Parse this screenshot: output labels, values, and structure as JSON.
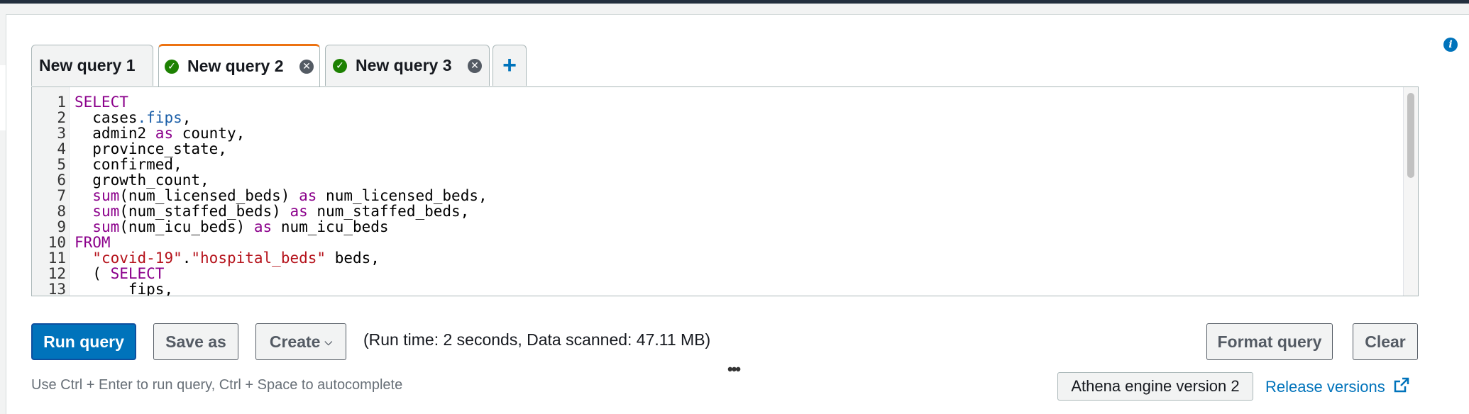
{
  "tabs": [
    {
      "label": "New query 1",
      "status": "none",
      "closable": false,
      "active": false
    },
    {
      "label": "New query 2",
      "status": "success",
      "closable": true,
      "active": true
    },
    {
      "label": "New query 3",
      "status": "success",
      "closable": true,
      "active": false
    }
  ],
  "add_tab_label": "+",
  "editor": {
    "line_numbers": [
      "1",
      "2",
      "3",
      "4",
      "5",
      "6",
      "7",
      "8",
      "9",
      "10",
      "11",
      "12",
      "13"
    ],
    "lines": [
      [
        {
          "t": "SELECT",
          "c": "kw"
        }
      ],
      [
        {
          "t": "  cases",
          "c": ""
        },
        {
          "t": ".fips",
          "c": "prop"
        },
        {
          "t": ",",
          "c": ""
        }
      ],
      [
        {
          "t": "  admin2 ",
          "c": ""
        },
        {
          "t": "as",
          "c": "kw"
        },
        {
          "t": " county,",
          "c": ""
        }
      ],
      [
        {
          "t": "  province_state,",
          "c": ""
        }
      ],
      [
        {
          "t": "  confirmed,",
          "c": ""
        }
      ],
      [
        {
          "t": "  growth_count,",
          "c": ""
        }
      ],
      [
        {
          "t": "  ",
          "c": ""
        },
        {
          "t": "sum",
          "c": "kw"
        },
        {
          "t": "(num_licensed_beds) ",
          "c": ""
        },
        {
          "t": "as",
          "c": "kw"
        },
        {
          "t": " num_licensed_beds,",
          "c": ""
        }
      ],
      [
        {
          "t": "  ",
          "c": ""
        },
        {
          "t": "sum",
          "c": "kw"
        },
        {
          "t": "(num_staffed_beds) ",
          "c": ""
        },
        {
          "t": "as",
          "c": "kw"
        },
        {
          "t": " num_staffed_beds,",
          "c": ""
        }
      ],
      [
        {
          "t": "  ",
          "c": ""
        },
        {
          "t": "sum",
          "c": "kw"
        },
        {
          "t": "(num_icu_beds) ",
          "c": ""
        },
        {
          "t": "as",
          "c": "kw"
        },
        {
          "t": " num_icu_beds",
          "c": ""
        }
      ],
      [
        {
          "t": "FROM",
          "c": "kw"
        }
      ],
      [
        {
          "t": "  ",
          "c": ""
        },
        {
          "t": "\"covid-19\"",
          "c": "str"
        },
        {
          "t": ".",
          "c": ""
        },
        {
          "t": "\"hospital_beds\"",
          "c": "str"
        },
        {
          "t": " beds,",
          "c": ""
        }
      ],
      [
        {
          "t": "  ( ",
          "c": ""
        },
        {
          "t": "SELECT",
          "c": "kw"
        }
      ],
      [
        {
          "t": "      fips,",
          "c": ""
        }
      ]
    ]
  },
  "toolbar": {
    "run_label": "Run query",
    "save_as_label": "Save as",
    "create_label": "Create",
    "run_info": "(Run time: 2 seconds, Data scanned: 47.11 MB)",
    "format_label": "Format query",
    "clear_label": "Clear",
    "resize_handle": "•••"
  },
  "footer": {
    "hint": "Use Ctrl + Enter to run query, Ctrl + Space to autocomplete",
    "engine_version": "Athena engine version 2",
    "release_link": "Release versions"
  },
  "icons": {
    "info": "info-icon",
    "success": "check-circle-icon",
    "close": "close-circle-icon",
    "external": "external-link-icon"
  },
  "colors": {
    "primary": "#0073bb",
    "active_tab_accent": "#ec7211",
    "success": "#1d8102",
    "keyword": "#8b008b",
    "string": "#b5121b",
    "property": "#1a5ea8"
  }
}
